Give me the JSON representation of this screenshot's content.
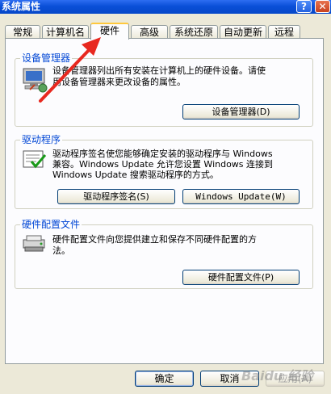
{
  "window": {
    "title": "系统属性",
    "help_button": "?",
    "close_button": "✕"
  },
  "tabs": [
    {
      "label": "常规"
    },
    {
      "label": "计算机名"
    },
    {
      "label": "硬件"
    },
    {
      "label": "高级"
    },
    {
      "label": "系统还原"
    },
    {
      "label": "自动更新"
    },
    {
      "label": "远程"
    }
  ],
  "active_tab": "硬件",
  "device_manager": {
    "title": "设备管理器",
    "desc_line1": "设备管理器列出所有安装在计算机上的硬件设备。请使",
    "desc_line2": "用设备管理器来更改设备的属性。",
    "button": "设备管理器(D)",
    "icon": "device-manager-icon"
  },
  "drivers": {
    "title": "驱动程序",
    "desc_line1": "驱动程序签名使您能够确定安装的驱动程序与 Windows",
    "desc_line2": "兼容。Windows Update 允许您设置 Windows 连接到",
    "desc_line3": "Windows Update 搜索驱动程序的方式。",
    "signing_button": "驱动程序签名(S)",
    "update_button": "Windows Update(W)",
    "icon": "driver-signing-icon"
  },
  "hardware_profiles": {
    "title": "硬件配置文件",
    "desc_line1": "硬件配置文件向您提供建立和保存不同硬件配置的方",
    "desc_line2": "法。",
    "button": "硬件配置文件(P)",
    "icon": "hardware-profile-icon"
  },
  "footer": {
    "ok": "确定",
    "cancel": "取消",
    "apply": "应用(A)"
  },
  "watermark": "Baidu 经验",
  "colors": {
    "title_bar": "#0a4fd8",
    "group_title": "#0046d5",
    "annotation_arrow": "#e8281f",
    "active_tab_accent": "#ffc83c"
  }
}
